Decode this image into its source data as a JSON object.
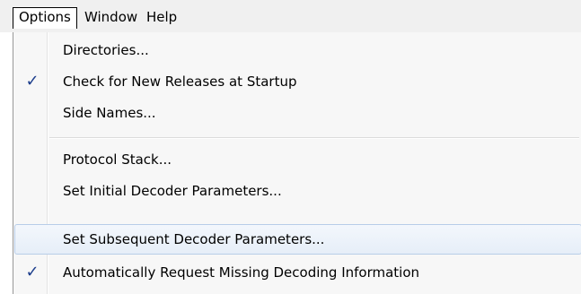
{
  "menubar": {
    "items": [
      {
        "label": "Options",
        "active": true
      },
      {
        "label": "Window",
        "active": false
      },
      {
        "label": "Help",
        "active": false
      }
    ]
  },
  "dropdown": {
    "items": [
      {
        "label": "Directories...",
        "checked": false,
        "highlighted": false
      },
      {
        "label": "Check for New Releases at Startup",
        "checked": true,
        "highlighted": false
      },
      {
        "label": "Side Names...",
        "checked": false,
        "highlighted": false
      },
      {
        "label": "Protocol Stack...",
        "checked": false,
        "highlighted": false
      },
      {
        "label": "Set Initial Decoder Parameters...",
        "checked": false,
        "highlighted": false
      },
      {
        "label": "Set Subsequent Decoder Parameters...",
        "checked": false,
        "highlighted": true
      },
      {
        "label": "Automatically Request Missing Decoding Information",
        "checked": true,
        "highlighted": false
      }
    ],
    "check_glyph": "✓",
    "check_color": "#1d3e8c",
    "highlight_color": "#e6eef8"
  }
}
